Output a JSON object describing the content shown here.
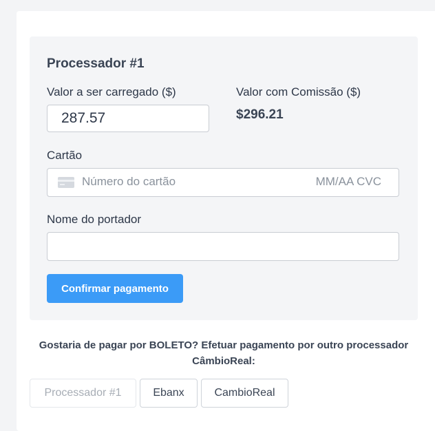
{
  "processor": {
    "title": "Processador #1",
    "amount_label": "Valor a ser carregado ($)",
    "amount_value": "287.57",
    "commission_label": "Valor com Comissão ($)",
    "commission_value": "$296.21",
    "card_label": "Cartão",
    "card_number_placeholder": "Número do cartão",
    "card_exp_cvc_placeholder": "MM/AA CVC",
    "card_icon": "credit-card-icon",
    "holder_label": "Nome do portador",
    "holder_value": "",
    "confirm_label": "Confirmar pagamento",
    "accent_color": "#3b9bf7"
  },
  "alternatives": {
    "prompt": "Gostaria de pagar por BOLETO? Efetuar pagamento por outro processador CâmbioReal:",
    "buttons": [
      {
        "label": "Processador #1",
        "state": "disabled"
      },
      {
        "label": "Ebanx",
        "state": "enabled"
      },
      {
        "label": "CambioReal",
        "state": "enabled"
      }
    ]
  }
}
